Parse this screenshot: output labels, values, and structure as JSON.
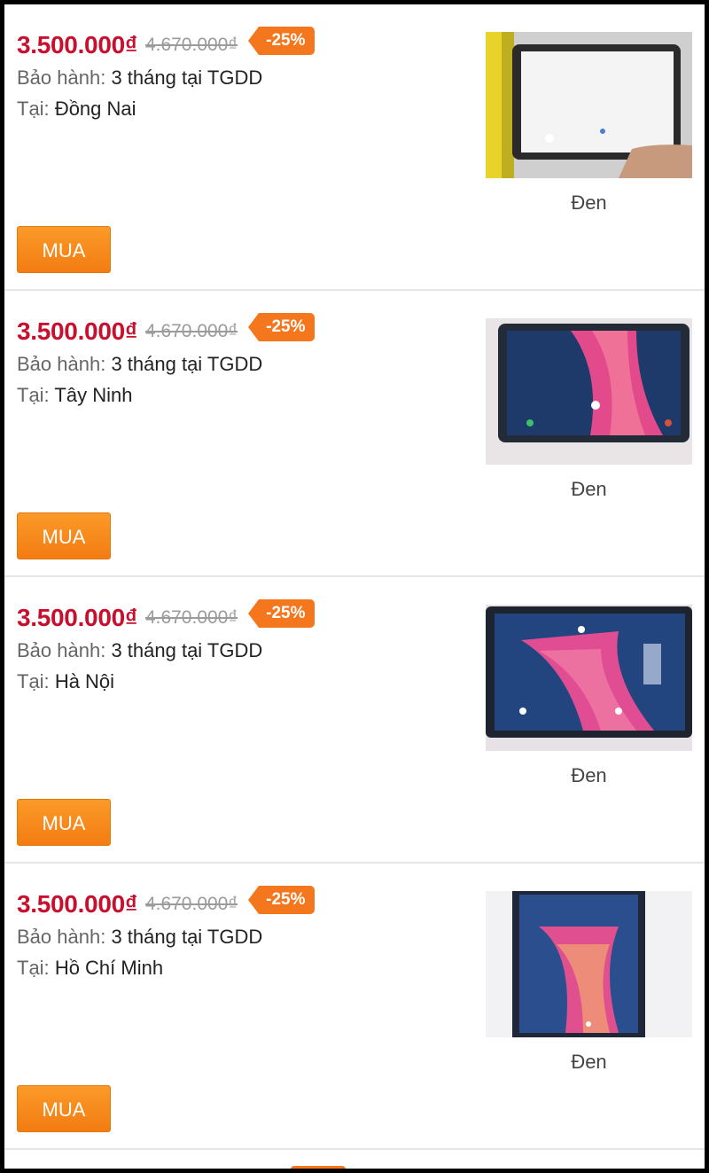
{
  "items": [
    {
      "price": "3.500.000₫",
      "old_price": "4.670.000₫",
      "discount": "-25%",
      "warranty_label": "Bảo hành:",
      "warranty_value": "3 tháng tại TGDD",
      "location_label": "Tại:",
      "location_value": "Đồng Nai",
      "color": "Đen",
      "buy_label": "MUA",
      "image": "tablet-photo-white-screen"
    },
    {
      "price": "3.500.000₫",
      "old_price": "4.670.000₫",
      "discount": "-25%",
      "warranty_label": "Bảo hành:",
      "warranty_value": "3 tháng tại TGDD",
      "location_label": "Tại:",
      "location_value": "Tây Ninh",
      "color": "Đen",
      "buy_label": "MUA",
      "image": "tablet-photo-lockscreen-landscape"
    },
    {
      "price": "3.500.000₫",
      "old_price": "4.670.000₫",
      "discount": "-25%",
      "warranty_label": "Bảo hành:",
      "warranty_value": "3 tháng tại TGDD",
      "location_label": "Tại:",
      "location_value": "Hà Nội",
      "color": "Đen",
      "buy_label": "MUA",
      "image": "tablet-photo-lockscreen-rotated"
    },
    {
      "price": "3.500.000₫",
      "old_price": "4.670.000₫",
      "discount": "-25%",
      "warranty_label": "Bảo hành:",
      "warranty_value": "3 tháng tại TGDD",
      "location_label": "Tại:",
      "location_value": "Hồ Chí Minh",
      "color": "Đen",
      "buy_label": "MUA",
      "image": "tablet-photo-portrait"
    }
  ],
  "colors": {
    "price": "#c8102e",
    "old_price": "#9b9b9b",
    "badge": "#f4761d",
    "buy_button": "#f7891a"
  }
}
